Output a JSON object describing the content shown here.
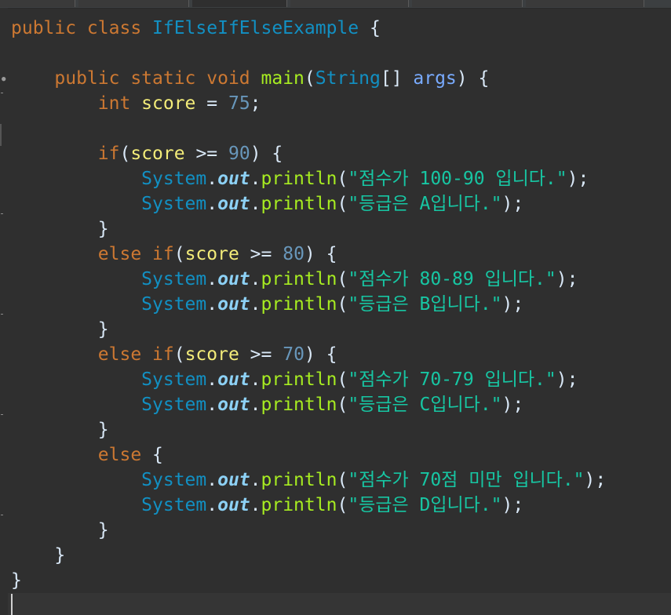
{
  "editor": {
    "lines": [
      [
        {
          "t": "public class ",
          "c": "kw"
        },
        {
          "t": "IfElseIfElseExample",
          "c": "cls"
        },
        {
          "t": " {",
          "c": "plain"
        }
      ],
      [],
      [
        {
          "t": "    public static void ",
          "c": "kw"
        },
        {
          "t": "main",
          "c": "fn"
        },
        {
          "t": "(",
          "c": "plain"
        },
        {
          "t": "String",
          "c": "cls"
        },
        {
          "t": "[] ",
          "c": "plain"
        },
        {
          "t": "args",
          "c": "param"
        },
        {
          "t": ") {",
          "c": "plain"
        }
      ],
      [
        {
          "t": "        int ",
          "c": "kw"
        },
        {
          "t": "score",
          "c": "var"
        },
        {
          "t": " = ",
          "c": "plain"
        },
        {
          "t": "75",
          "c": "num"
        },
        {
          "t": ";",
          "c": "plain"
        }
      ],
      [],
      [
        {
          "t": "        if",
          "c": "kw"
        },
        {
          "t": "(",
          "c": "plain"
        },
        {
          "t": "score",
          "c": "var"
        },
        {
          "t": " >= ",
          "c": "plain"
        },
        {
          "t": "90",
          "c": "num"
        },
        {
          "t": ") {",
          "c": "plain"
        }
      ],
      [
        {
          "t": "            System",
          "c": "cls"
        },
        {
          "t": ".",
          "c": "plain"
        },
        {
          "t": "out",
          "c": "field"
        },
        {
          "t": ".",
          "c": "plain"
        },
        {
          "t": "println",
          "c": "fn"
        },
        {
          "t": "(",
          "c": "plain"
        },
        {
          "t": "\"점수가 100-90 입니다.\"",
          "c": "str"
        },
        {
          "t": ");",
          "c": "plain"
        }
      ],
      [
        {
          "t": "            System",
          "c": "cls"
        },
        {
          "t": ".",
          "c": "plain"
        },
        {
          "t": "out",
          "c": "field"
        },
        {
          "t": ".",
          "c": "plain"
        },
        {
          "t": "println",
          "c": "fn"
        },
        {
          "t": "(",
          "c": "plain"
        },
        {
          "t": "\"등급은 A입니다.\"",
          "c": "str"
        },
        {
          "t": ");",
          "c": "plain"
        }
      ],
      [
        {
          "t": "        }",
          "c": "plain"
        }
      ],
      [
        {
          "t": "        else if",
          "c": "kw"
        },
        {
          "t": "(",
          "c": "plain"
        },
        {
          "t": "score",
          "c": "var"
        },
        {
          "t": " >= ",
          "c": "plain"
        },
        {
          "t": "80",
          "c": "num"
        },
        {
          "t": ") {",
          "c": "plain"
        }
      ],
      [
        {
          "t": "            System",
          "c": "cls"
        },
        {
          "t": ".",
          "c": "plain"
        },
        {
          "t": "out",
          "c": "field"
        },
        {
          "t": ".",
          "c": "plain"
        },
        {
          "t": "println",
          "c": "fn"
        },
        {
          "t": "(",
          "c": "plain"
        },
        {
          "t": "\"점수가 80-89 입니다.\"",
          "c": "str"
        },
        {
          "t": ");",
          "c": "plain"
        }
      ],
      [
        {
          "t": "            System",
          "c": "cls"
        },
        {
          "t": ".",
          "c": "plain"
        },
        {
          "t": "out",
          "c": "field"
        },
        {
          "t": ".",
          "c": "plain"
        },
        {
          "t": "println",
          "c": "fn"
        },
        {
          "t": "(",
          "c": "plain"
        },
        {
          "t": "\"등급은 B입니다.\"",
          "c": "str"
        },
        {
          "t": ");",
          "c": "plain"
        }
      ],
      [
        {
          "t": "        }",
          "c": "plain"
        }
      ],
      [
        {
          "t": "        else if",
          "c": "kw"
        },
        {
          "t": "(",
          "c": "plain"
        },
        {
          "t": "score",
          "c": "var"
        },
        {
          "t": " >= ",
          "c": "plain"
        },
        {
          "t": "70",
          "c": "num"
        },
        {
          "t": ") {",
          "c": "plain"
        }
      ],
      [
        {
          "t": "            System",
          "c": "cls"
        },
        {
          "t": ".",
          "c": "plain"
        },
        {
          "t": "out",
          "c": "field"
        },
        {
          "t": ".",
          "c": "plain"
        },
        {
          "t": "println",
          "c": "fn"
        },
        {
          "t": "(",
          "c": "plain"
        },
        {
          "t": "\"점수가 70-79 입니다.\"",
          "c": "str"
        },
        {
          "t": ");",
          "c": "plain"
        }
      ],
      [
        {
          "t": "            System",
          "c": "cls"
        },
        {
          "t": ".",
          "c": "plain"
        },
        {
          "t": "out",
          "c": "field"
        },
        {
          "t": ".",
          "c": "plain"
        },
        {
          "t": "println",
          "c": "fn"
        },
        {
          "t": "(",
          "c": "plain"
        },
        {
          "t": "\"등급은 C입니다.\"",
          "c": "str"
        },
        {
          "t": ");",
          "c": "plain"
        }
      ],
      [
        {
          "t": "        }",
          "c": "plain"
        }
      ],
      [
        {
          "t": "        else",
          "c": "kw"
        },
        {
          "t": " {",
          "c": "plain"
        }
      ],
      [
        {
          "t": "            System",
          "c": "cls"
        },
        {
          "t": ".",
          "c": "plain"
        },
        {
          "t": "out",
          "c": "field"
        },
        {
          "t": ".",
          "c": "plain"
        },
        {
          "t": "println",
          "c": "fn"
        },
        {
          "t": "(",
          "c": "plain"
        },
        {
          "t": "\"점수가 70점 미만 입니다.\"",
          "c": "str"
        },
        {
          "t": ");",
          "c": "plain"
        }
      ],
      [
        {
          "t": "            System",
          "c": "cls"
        },
        {
          "t": ".",
          "c": "plain"
        },
        {
          "t": "out",
          "c": "field"
        },
        {
          "t": ".",
          "c": "plain"
        },
        {
          "t": "println",
          "c": "fn"
        },
        {
          "t": "(",
          "c": "plain"
        },
        {
          "t": "\"등급은 D입니다.\"",
          "c": "str"
        },
        {
          "t": ");",
          "c": "plain"
        }
      ],
      [
        {
          "t": "        }",
          "c": "plain"
        }
      ],
      [
        {
          "t": "    }",
          "c": "plain"
        }
      ],
      [
        {
          "t": "}",
          "c": "plain"
        }
      ]
    ]
  },
  "theme": {
    "background": "#2f2f2f",
    "keyword": "#cc7832",
    "class": "#1290c3",
    "method": "#a7ec21",
    "string": "#17c6a3",
    "number": "#6897bb",
    "variable": "#f3ec79",
    "parameter": "#79abff",
    "field": "#8dd1f5"
  }
}
